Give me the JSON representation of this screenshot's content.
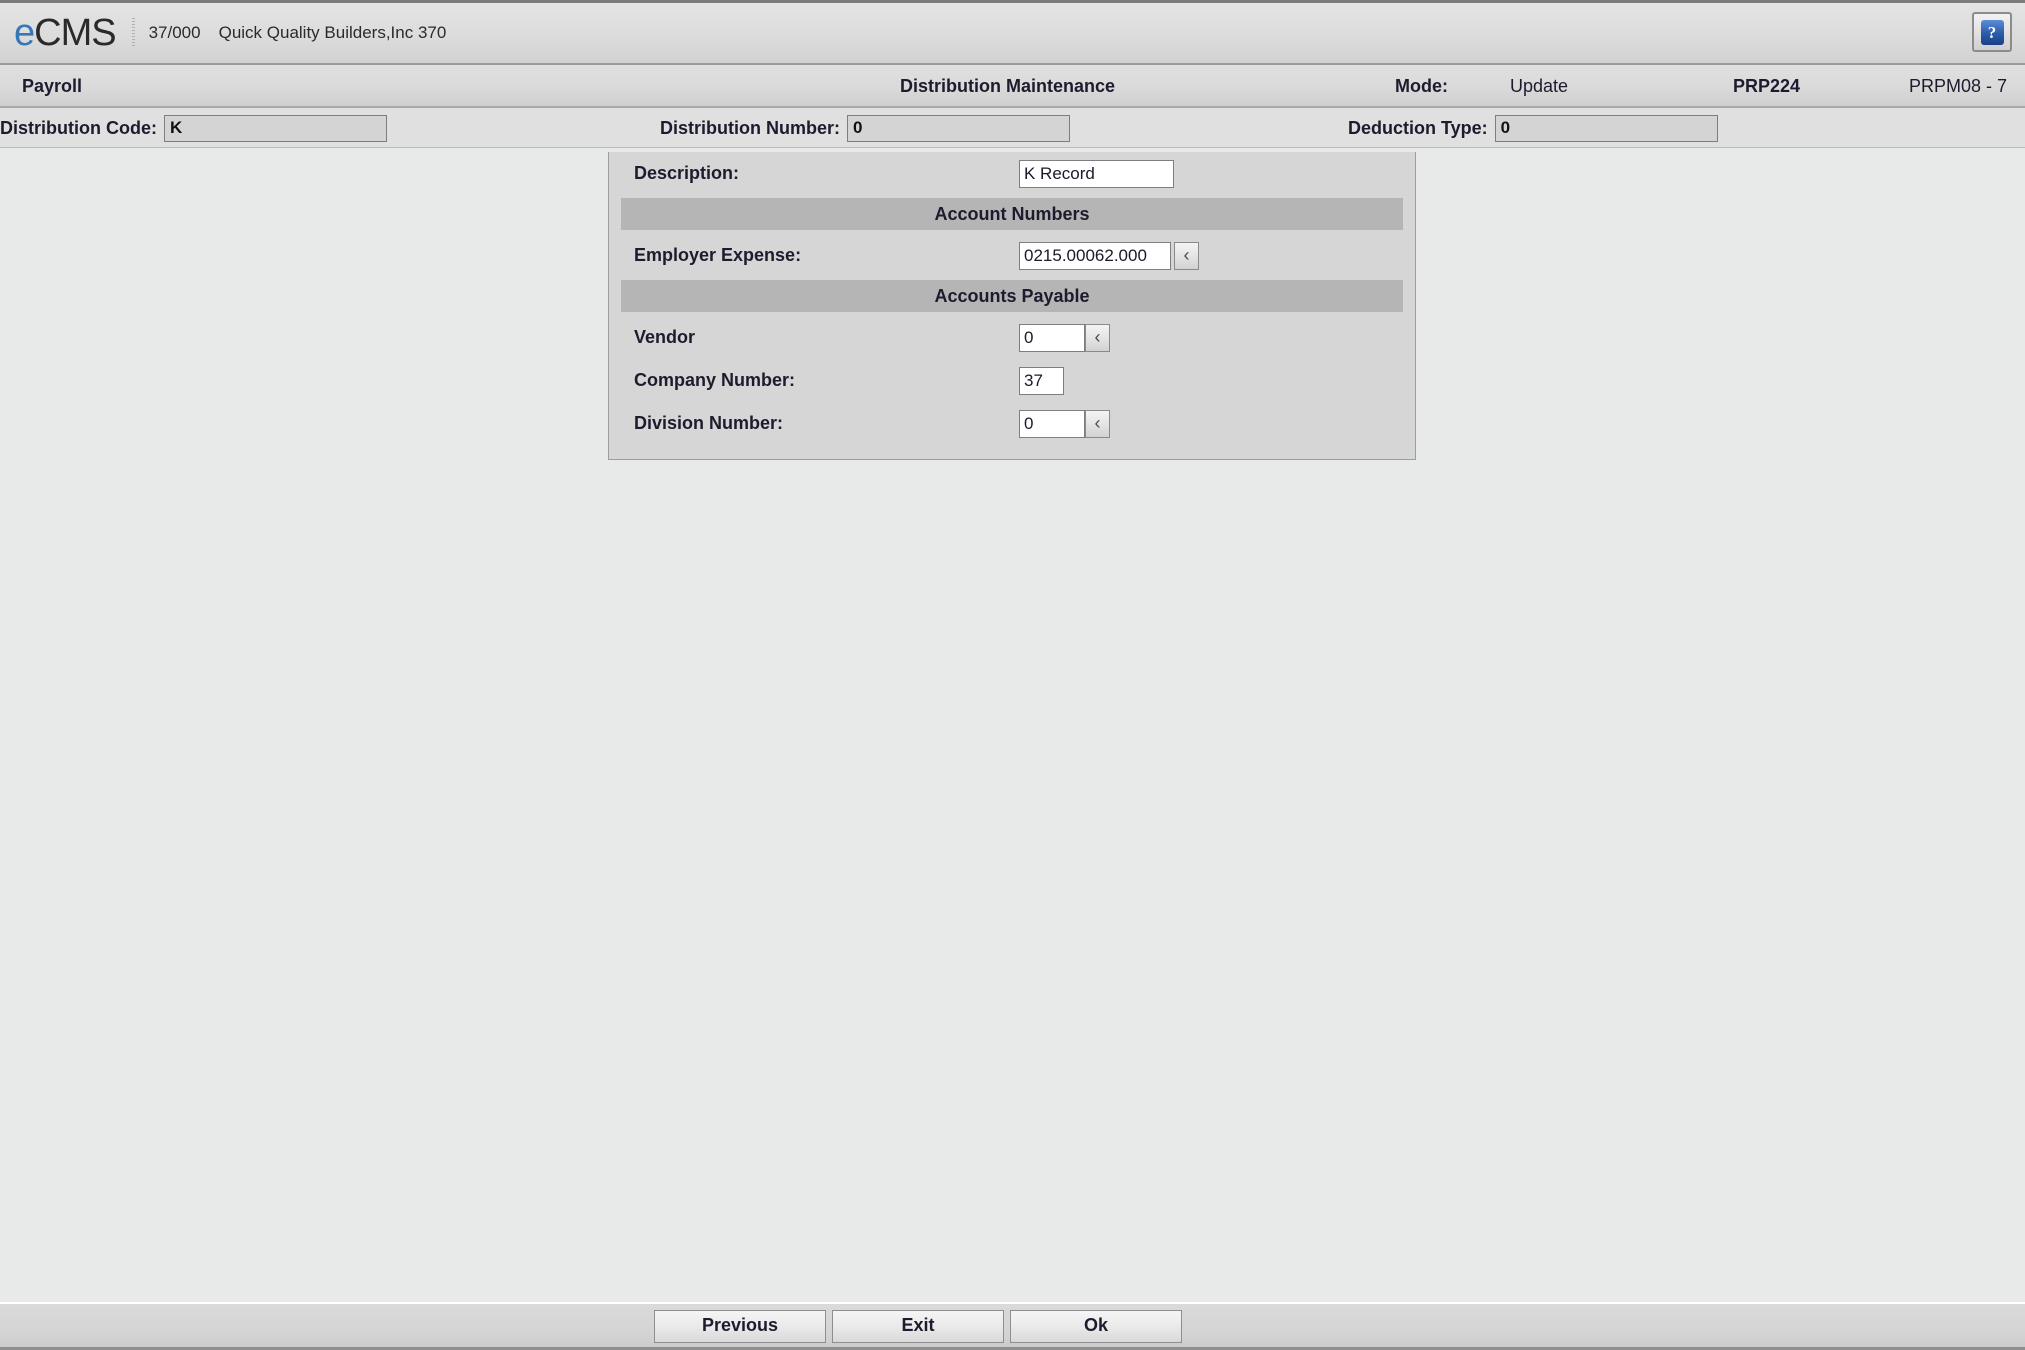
{
  "header": {
    "logo_prefix": "e",
    "logo_rest": "CMS",
    "company_id": "37/000",
    "company_name": "Quick Quality Builders,Inc 370",
    "help_glyph": "?"
  },
  "modulebar": {
    "module": "Payroll",
    "title": "Distribution Maintenance",
    "mode_label": "Mode:",
    "mode_value": "Update",
    "program": "PRP224",
    "screen": "PRPM08 - 7"
  },
  "keybar": {
    "distribution_code": {
      "label": "Distribution Code:",
      "value": "K"
    },
    "distribution_number": {
      "label": "Distribution Number:",
      "value": "0"
    },
    "deduction_type": {
      "label": "Deduction Type:",
      "value": "0"
    }
  },
  "form": {
    "description": {
      "label": "Description:",
      "value": "K Record"
    },
    "section_account_numbers": "Account Numbers",
    "employer_expense": {
      "label": "Employer Expense:",
      "value": "0215.00062.000",
      "lookup": "‹"
    },
    "section_accounts_payable": "Accounts Payable",
    "vendor": {
      "label": "Vendor",
      "value": "0",
      "lookup": "‹"
    },
    "company_number": {
      "label": "Company Number:",
      "value": "37"
    },
    "division_number": {
      "label": "Division Number:",
      "value": "0",
      "lookup": "‹"
    }
  },
  "footer": {
    "previous": "Previous",
    "exit": "Exit",
    "ok": "Ok"
  },
  "colors": {
    "accent_blue": "#3577b8",
    "page_bg": "#e8e9e9",
    "panel_bg": "#d6d6d6",
    "band_gray": "#b5b5b5"
  }
}
